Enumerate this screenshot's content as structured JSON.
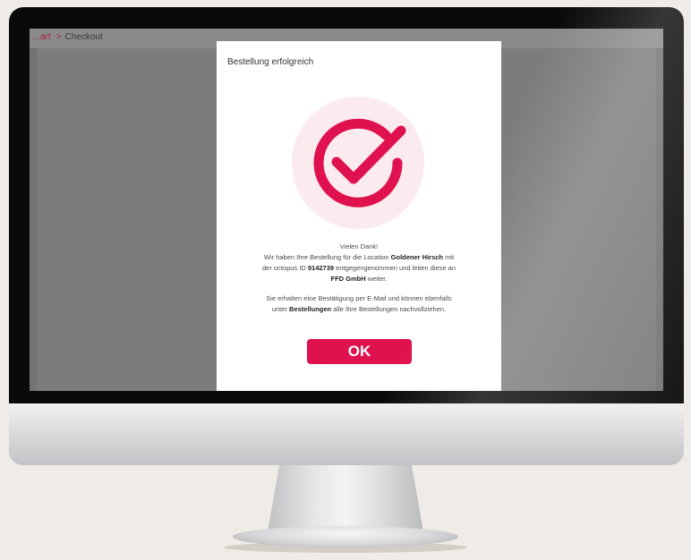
{
  "breadcrumb": {
    "parent_label": "…art",
    "separator": ">",
    "current_label": "Checkout"
  },
  "modal": {
    "title": "Bestellung erfolgreich",
    "thanks": "Vielen Dank!",
    "line1_prefix": "Wir haben Ihre Bestellung für die Location",
    "location_name": "Goldener Hirsch",
    "line1_suffix": "mit",
    "line2_prefix": "der octopus ID",
    "octopus_id": "9142739",
    "line2_suffix": "entgegengenommen und leiten diese an",
    "company": "FFD GmbH",
    "line3_suffix": "weiter.",
    "line4": "Sie erhalten eine Bestätigung per E-Mail und können ebenfalls",
    "line5_prefix": "unter",
    "orders_link": "Bestellungen",
    "line5_suffix": "alle Ihre Bestellungen nachvollziehen.",
    "ok_label": "OK"
  },
  "icons": {
    "success": "check-circle-icon"
  },
  "colors": {
    "accent": "#e0114f",
    "accent_light": "#fbeaee",
    "background": "#efebe6",
    "overlay": "#737373"
  }
}
